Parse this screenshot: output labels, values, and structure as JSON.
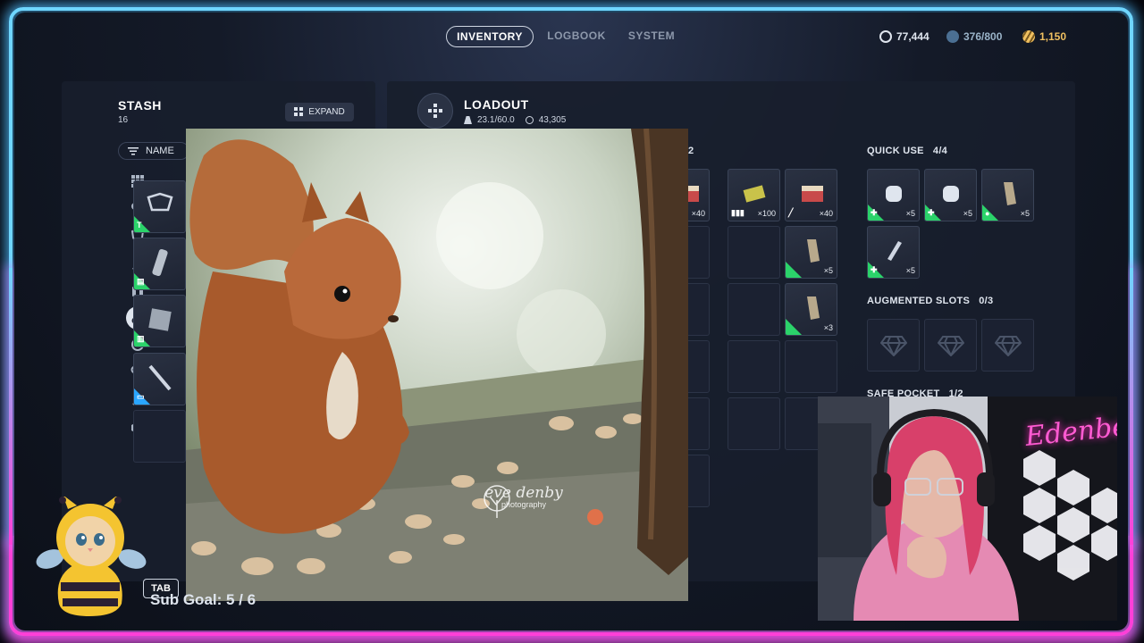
{
  "nav": {
    "tabs": [
      {
        "label": "INVENTORY",
        "active": true
      },
      {
        "label": "LOGBOOK",
        "active": false
      },
      {
        "label": "SYSTEM",
        "active": false
      }
    ],
    "currencies": [
      {
        "icon": "coin-icon",
        "value": "77,444",
        "color": "#dfe5ee"
      },
      {
        "icon": "storage-icon",
        "value": "376/800",
        "color": "#9ab3c8"
      },
      {
        "icon": "token-icon",
        "value": "1,150",
        "color": "#f0c060"
      }
    ]
  },
  "stash": {
    "title": "STASH",
    "count": "16",
    "expand_label": "EXPAND",
    "sort_label": "NAME",
    "categories": [
      "grid-icon",
      "attachments-icon",
      "shield-icon",
      "weapon-icon",
      "ammo-icon",
      "consumable-icon",
      "augment-icon",
      "key-icon",
      "wrench-icon",
      "cube-icon"
    ],
    "active_category": 5,
    "items": [
      {
        "rarity": "green",
        "tag": "T"
      },
      {
        "rarity": "green",
        "tag": "▤"
      },
      {
        "rarity": "green",
        "tag": "▥"
      },
      {
        "rarity": "blue",
        "tag": "▭"
      }
    ]
  },
  "loadout": {
    "title": "LOADOUT",
    "weight": "23.1/60.0",
    "value": "43,305",
    "backpack_fragment": "2",
    "backpack_items": [
      {
        "qty": "×40"
      },
      {
        "qty": "×100"
      },
      {
        "qty": "×40"
      },
      {
        "qty": "×5"
      },
      {
        "qty": "×3"
      }
    ],
    "quick_use": {
      "label": "QUICK USE",
      "count": "4/4",
      "qty": [
        "×5",
        "×5",
        "×5",
        "×5"
      ]
    },
    "augmented": {
      "label": "AUGMENTED SLOTS",
      "count": "0/3"
    },
    "safe_pocket": {
      "label": "SAFE POCKET",
      "count": "1/2"
    }
  },
  "overlay": {
    "watermark_name": "eve denby",
    "watermark_sub": "photography",
    "webcam_sign": "Edenbe",
    "tab_key": "TAB",
    "sub_goal": "Sub Goal:  5 / 6"
  },
  "colors": {
    "rarity_green": "#2bd36a",
    "rarity_blue": "#2aa6ff",
    "neon_blue": "#6fd6ff",
    "neon_pink": "#ff3fd8"
  }
}
